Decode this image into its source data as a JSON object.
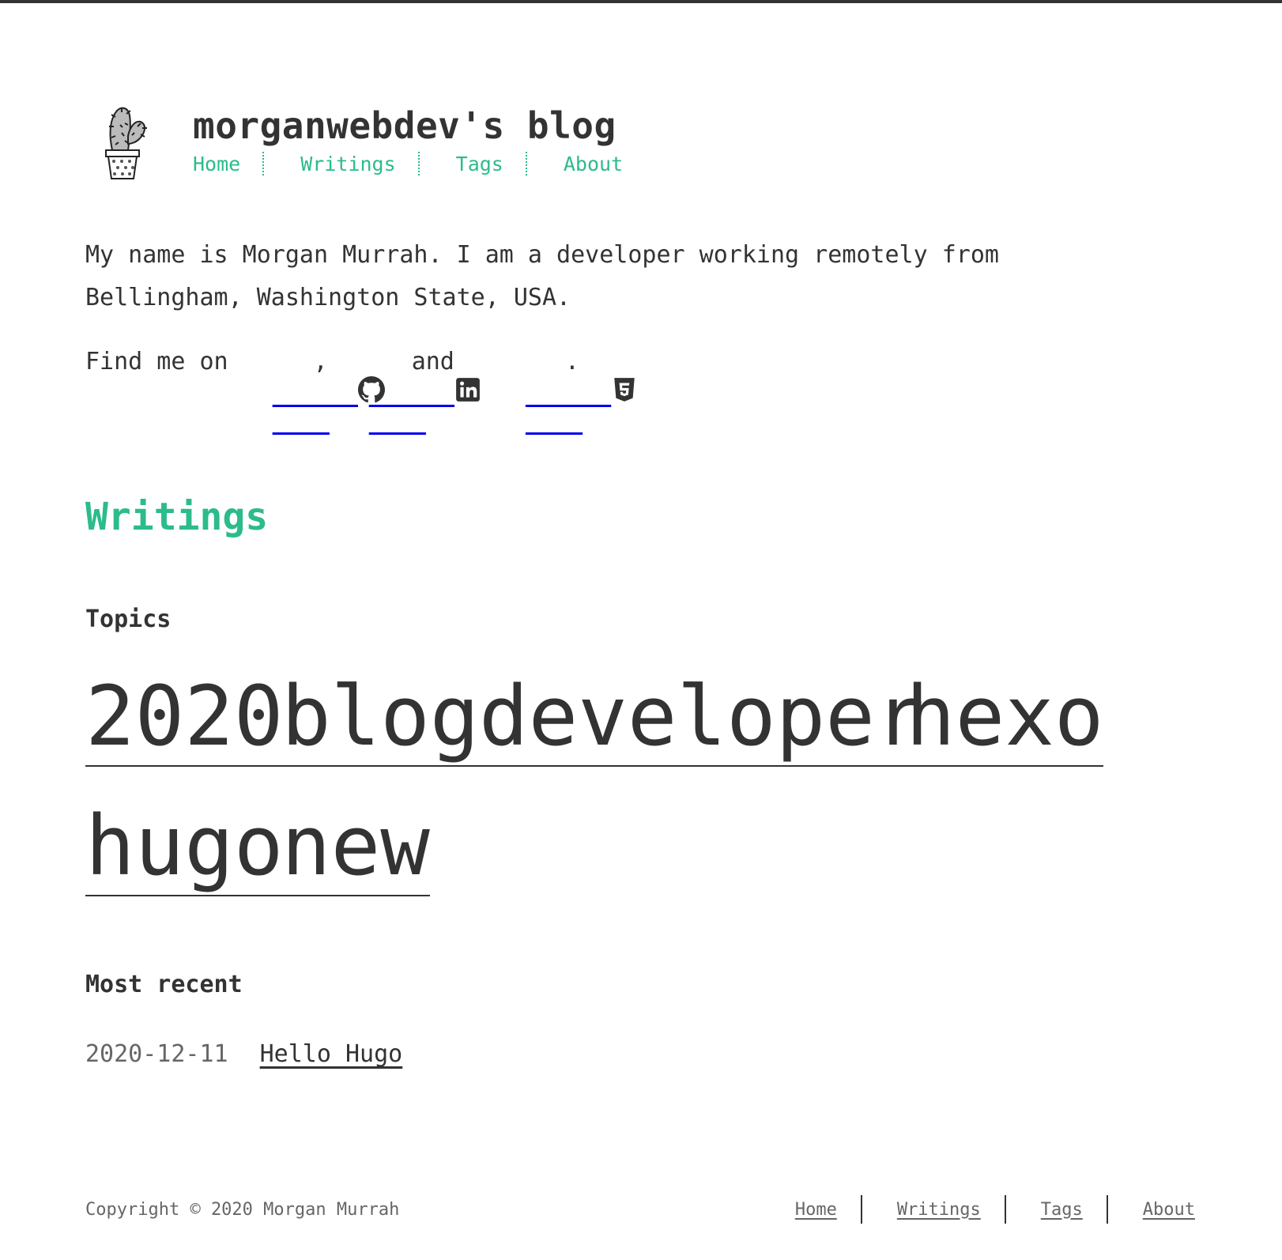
{
  "site": {
    "title": "morganwebdev's blog"
  },
  "nav": {
    "items": [
      "Home",
      "Writings",
      "Tags",
      "About"
    ]
  },
  "about": {
    "intro": "My name is Morgan Murrah. I am a developer working remotely from Bellingham, Washington State, USA.",
    "find_prefix": "Find me on",
    "comma": ",",
    "and": "and",
    "period": ".",
    "icons": [
      "github-icon",
      "linkedin-icon",
      "html5-icon"
    ]
  },
  "writings": {
    "title": "Writings",
    "topics_title": "Topics",
    "tags": [
      "2020",
      "blog",
      "developer",
      "hexo",
      "hugo",
      "new"
    ],
    "recent_title": "Most recent",
    "recent": [
      {
        "date": "2020-12-11",
        "title": "Hello Hugo"
      }
    ]
  },
  "footer": {
    "copyright": "Copyright © 2020 Morgan Murrah",
    "nav": [
      "Home",
      "Writings",
      "Tags",
      "About"
    ]
  },
  "colors": {
    "accent": "#2bbc8a",
    "text": "#333333",
    "muted": "#666666"
  }
}
